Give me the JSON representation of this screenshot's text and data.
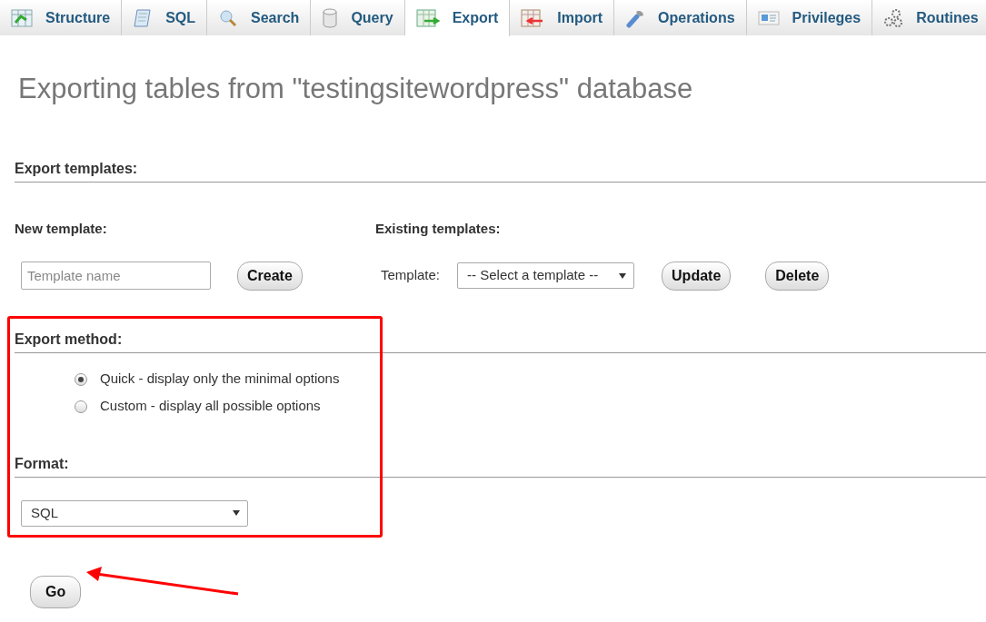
{
  "tabs": [
    {
      "label": "Structure",
      "selected": false
    },
    {
      "label": "SQL",
      "selected": false
    },
    {
      "label": "Search",
      "selected": false
    },
    {
      "label": "Query",
      "selected": false
    },
    {
      "label": "Export",
      "selected": true
    },
    {
      "label": "Import",
      "selected": false
    },
    {
      "label": "Operations",
      "selected": false
    },
    {
      "label": "Privileges",
      "selected": false
    },
    {
      "label": "Routines",
      "selected": false
    }
  ],
  "page_title": "Exporting tables from \"testingsitewordpress\" database",
  "export_templates": {
    "heading": "Export templates:",
    "new_template": {
      "heading": "New template:",
      "placeholder": "Template name",
      "button": "Create"
    },
    "existing_templates": {
      "heading": "Existing templates:",
      "label": "Template:",
      "select_value": "-- Select a template --",
      "buttons": [
        "Update",
        "Delete"
      ]
    }
  },
  "export_method": {
    "heading": "Export method:",
    "options": [
      {
        "label": "Quick - display only the minimal options",
        "selected": true
      },
      {
        "label": "Custom - display all possible options",
        "selected": false
      }
    ]
  },
  "format": {
    "heading": "Format:",
    "value": "SQL"
  },
  "go_button": "Go",
  "annotations": {
    "highlight_frame": true,
    "arrow": true
  }
}
